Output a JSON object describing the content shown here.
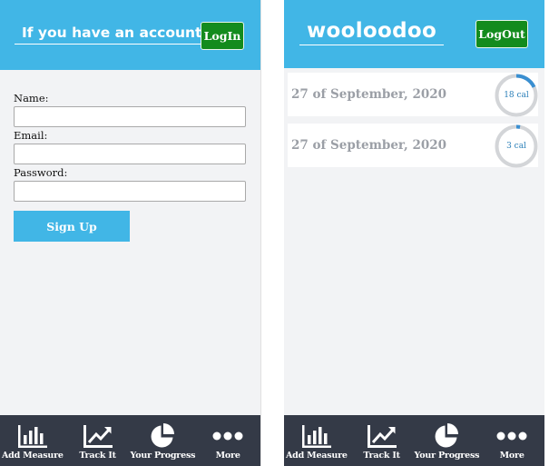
{
  "left_screen": {
    "header": {
      "title": "If you have an account:",
      "login_label": "LogIn"
    },
    "form": {
      "name_label": "Name:",
      "email_label": "Email:",
      "password_label": "Password:",
      "name_value": "",
      "email_value": "",
      "password_value": "",
      "signup_label": "Sign Up"
    }
  },
  "right_screen": {
    "header": {
      "title": "wooloodoo",
      "logout_label": "LogOut"
    },
    "entries": [
      {
        "date": "27 of September, 2020",
        "calories": "18 cal",
        "progress": 0.18
      },
      {
        "date": "27 of September, 2020",
        "calories": "3 cal",
        "progress": 0.03
      }
    ]
  },
  "nav": {
    "items": [
      {
        "label": "Add Measure",
        "icon": "bar-chart-icon"
      },
      {
        "label": "Track It",
        "icon": "trend-line-icon"
      },
      {
        "label": "Your Progress",
        "icon": "pie-chart-icon"
      },
      {
        "label": "More",
        "icon": "more-dots-icon"
      }
    ]
  },
  "colors": {
    "header_blue": "#41b6e6",
    "button_green": "#138b1d",
    "nav_dark": "#343a47",
    "ring_track": "#d3d5d8",
    "ring_progress": "#3a8fd1"
  }
}
